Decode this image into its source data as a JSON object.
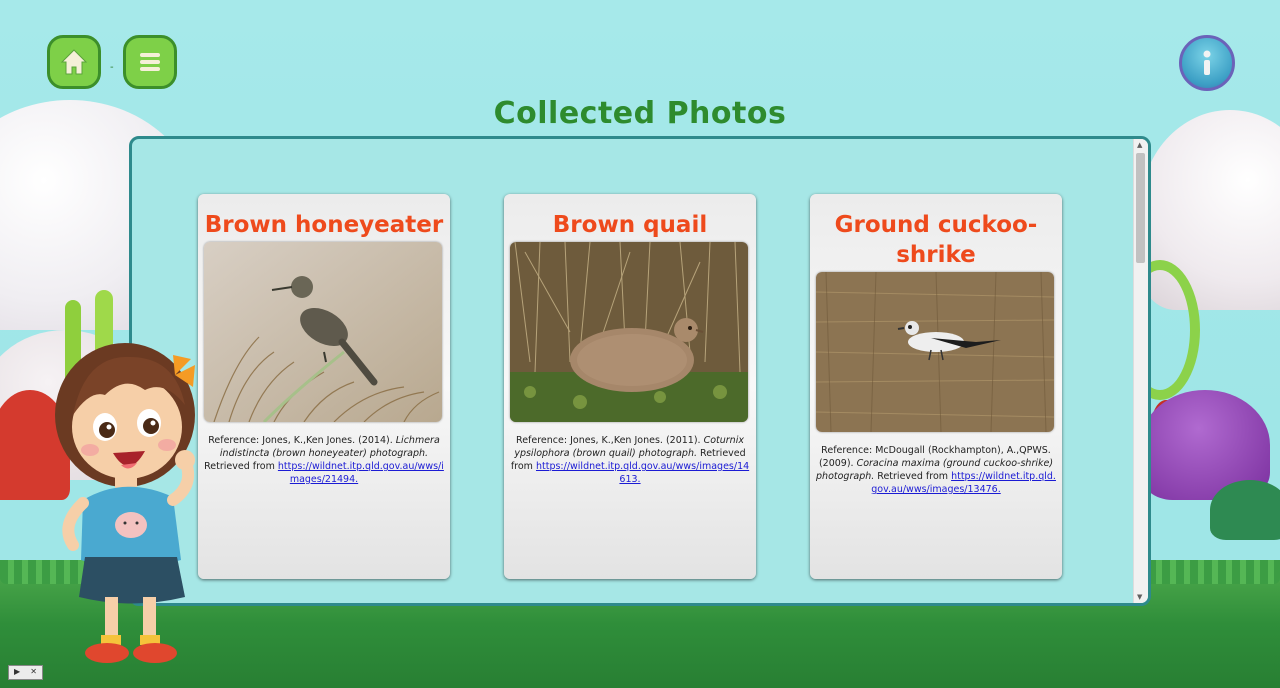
{
  "page": {
    "title": "Collected Photos"
  },
  "nav": {
    "home_icon": "home-icon",
    "menu_icon": "menu-icon",
    "info_icon": "info-icon",
    "separator": "-"
  },
  "cards": [
    {
      "name": "Brown honeyeater",
      "ref_prefix": "Reference: Jones, K.,Ken Jones. (2014). ",
      "ref_italic": "Lichmera indistincta (brown honeyeater) photograph.",
      "ref_retrieved": " Retrieved from ",
      "ref_link": "https://wildnet.itp.qld.gov.au/wws/images/21494."
    },
    {
      "name": "Brown quail",
      "ref_prefix": "Reference: Jones, K.,Ken Jones. (2011). ",
      "ref_italic": "Coturnix ypsilophora (brown quail) photograph.",
      "ref_retrieved": " Retrieved from ",
      "ref_link": "https://wildnet.itp.qld.gov.au/wws/images/14613."
    },
    {
      "name": "Ground cuckoo-shrike",
      "ref_prefix": "Reference: McDougall (Rockhampton), A.,QPWS. (2009). ",
      "ref_italic": "Coracina maxima (ground cuckoo-shrike) photograph.",
      "ref_retrieved": " Retrieved from ",
      "ref_link": "https://wildnet.itp.qld.gov.au/wws/images/13476."
    }
  ],
  "media_controls": {
    "play": "▶",
    "close": "✕"
  },
  "colors": {
    "background": "#a6e9ea",
    "title_green": "#2e8b2e",
    "card_title": "#ee4a1c",
    "button_green": "#7ed048",
    "link": "#1b1bd4"
  }
}
